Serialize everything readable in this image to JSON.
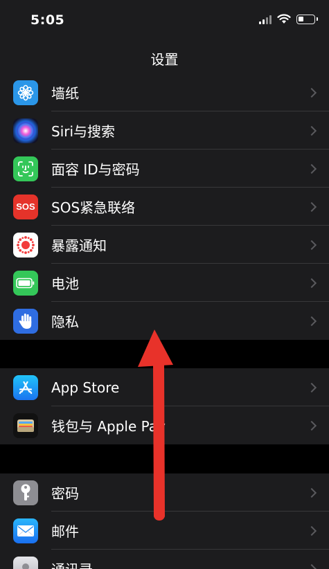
{
  "status_bar": {
    "time": "5:05",
    "battery_level": 0.3
  },
  "nav": {
    "title": "设置"
  },
  "groups": [
    {
      "items": [
        {
          "label": "墙纸",
          "icon": "wallpaper-icon",
          "color": "#2b96e8"
        },
        {
          "label": "Siri与搜索",
          "icon": "siri-icon",
          "color": "#1a1a2e"
        },
        {
          "label": "面容 ID与密码",
          "icon": "face-id-icon",
          "color": "#34c759"
        },
        {
          "label": "SOS紧急联络",
          "icon": "sos-icon",
          "color": "#e5332a",
          "badge": "SOS"
        },
        {
          "label": "暴露通知",
          "icon": "exposure-notification-icon",
          "color": "#ffffff"
        },
        {
          "label": "电池",
          "icon": "battery-icon",
          "color": "#34c759"
        },
        {
          "label": "隐私",
          "icon": "privacy-hand-icon",
          "color": "#2f6de1"
        }
      ]
    },
    {
      "items": [
        {
          "label": "App Store",
          "icon": "app-store-icon",
          "color": "#1b8ef5"
        },
        {
          "label": "钱包与 Apple Pay",
          "icon": "wallet-icon",
          "color": "#111111"
        }
      ]
    },
    {
      "items": [
        {
          "label": "密码",
          "icon": "key-icon",
          "color": "#8e8e93"
        },
        {
          "label": "邮件",
          "icon": "mail-icon",
          "color": "#1b8ef5"
        },
        {
          "label": "通讯录",
          "icon": "contacts-icon",
          "color": "#c7c7cc"
        }
      ]
    }
  ],
  "annotation": {
    "arrow_color": "#e8322a"
  }
}
